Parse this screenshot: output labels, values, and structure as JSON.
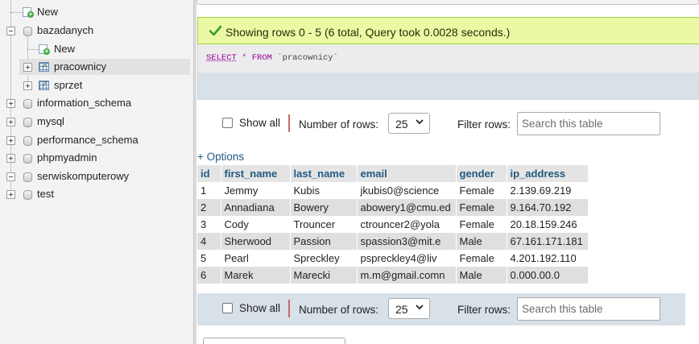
{
  "nav": {
    "items": [
      {
        "label": "New",
        "type": "new",
        "depth": 0
      },
      {
        "label": "bazadanych",
        "type": "db",
        "expanded": true
      },
      {
        "label": "New",
        "type": "new",
        "depth": 1
      },
      {
        "label": "pracownicy",
        "type": "table",
        "selected": true
      },
      {
        "label": "sprzet",
        "type": "table"
      },
      {
        "label": "information_schema",
        "type": "db"
      },
      {
        "label": "mysql",
        "type": "db"
      },
      {
        "label": "performance_schema",
        "type": "db"
      },
      {
        "label": "phpmyadmin",
        "type": "db"
      },
      {
        "label": "serwiskomputerowy",
        "type": "db",
        "expanded": true
      },
      {
        "label": "test",
        "type": "db"
      }
    ]
  },
  "success": {
    "message": "Showing rows 0 - 5 (6 total, Query took 0.0028 seconds.)",
    "color": "#ebf8a4"
  },
  "sql": {
    "select_kw": "SELECT",
    "star": "*",
    "from_kw": "FROM",
    "table": "`pracownicy`"
  },
  "controls_top": {
    "show_all_label": "Show all",
    "rows_label": "Number of rows:",
    "rows_value": "25",
    "filter_label": "Filter rows:",
    "search_placeholder": "Search this table"
  },
  "controls_bottom": {
    "show_all_label": "Show all",
    "rows_label": "Number of rows:",
    "rows_value": "25",
    "filter_label": "Filter rows:",
    "search_placeholder": "Search this table"
  },
  "options_link": "+ Options",
  "table": {
    "columns": [
      "id",
      "first_name",
      "last_name",
      "email",
      "gender",
      "ip_address"
    ],
    "rows": [
      [
        "1",
        "Jemmy",
        "Kubis",
        "jkubis0@science",
        "Female",
        "2.139.69.219"
      ],
      [
        "2",
        "Annadiana",
        "Bowery",
        "abowery1@cmu.ed",
        "Female",
        "9.164.70.192"
      ],
      [
        "3",
        "Cody",
        "Trouncer",
        "ctrouncer2@yola",
        "Female",
        "20.18.159.246"
      ],
      [
        "4",
        "Sherwood",
        "Passion",
        "spassion3@mit.e",
        "Male",
        "67.161.171.181"
      ],
      [
        "5",
        "Pearl",
        "Spreckley",
        "pspreckley4@liv",
        "Female",
        "4.201.192.110"
      ],
      [
        "6",
        "Marek",
        "Marecki",
        "m.m@gmail.comn",
        "Male",
        "0.000.00.0"
      ]
    ]
  },
  "colors": {
    "link": "#235a81",
    "sql_keyword": "#990099",
    "row_alt": "#dfdfdf"
  }
}
